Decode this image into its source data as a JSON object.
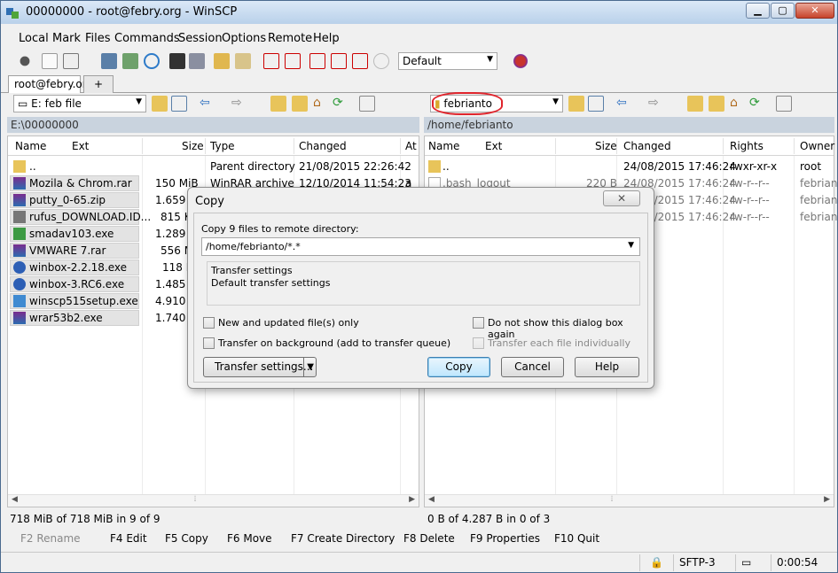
{
  "window": {
    "title": "00000000 - root@febry.org - WinSCP",
    "min": "▁",
    "max": "▢",
    "close": "✕"
  },
  "menu": [
    "Local",
    "Mark",
    "Files",
    "Commands",
    "Session",
    "Options",
    "Remote",
    "Help"
  ],
  "toolbar": {
    "transfer_profile": "Default"
  },
  "tabs": {
    "session": "root@febry.org",
    "new": "+"
  },
  "left_pane": {
    "drive": "E: feb file",
    "path": "E:\\00000000",
    "columns": [
      "Name",
      "Ext",
      "Size",
      "Type",
      "Changed",
      "At"
    ],
    "rows": [
      {
        "name": "..",
        "size": "",
        "type": "Parent directory",
        "changed": "21/08/2015  22:26:42",
        "attr": "",
        "icon": "folder-up-icon"
      },
      {
        "name": "Mozila & Chrom.rar",
        "size": "150 MiB",
        "type": "WinRAR archive",
        "changed": "12/10/2014  11:54:23",
        "attr": "a",
        "icon": "rar-icon"
      },
      {
        "name": "putty_0-65.zip",
        "size": "1.659 K",
        "type": "",
        "changed": "",
        "attr": "",
        "icon": "rar-icon"
      },
      {
        "name": "rufus_DOWNLOAD.ID...",
        "size": "815 K",
        "type": "",
        "changed": "",
        "attr": "",
        "icon": "usb-icon"
      },
      {
        "name": "smadav103.exe",
        "size": "1.289 K",
        "type": "",
        "changed": "",
        "attr": "",
        "icon": "exe-icon"
      },
      {
        "name": "VMWARE 7.rar",
        "size": "556 M",
        "type": "",
        "changed": "",
        "attr": "",
        "icon": "rar-icon"
      },
      {
        "name": "winbox-2.2.18.exe",
        "size": "118 K",
        "type": "",
        "changed": "",
        "attr": "",
        "icon": "winbox-icon"
      },
      {
        "name": "winbox-3.RC6.exe",
        "size": "1.485 K",
        "type": "",
        "changed": "",
        "attr": "",
        "icon": "winbox-icon"
      },
      {
        "name": "winscp515setup.exe",
        "size": "4.910 K",
        "type": "",
        "changed": "",
        "attr": "",
        "icon": "setup-icon"
      },
      {
        "name": "wrar53b2.exe",
        "size": "1.740 K",
        "type": "",
        "changed": "",
        "attr": "",
        "icon": "rar-icon"
      }
    ],
    "status": "718 MiB of 718 MiB in 9 of 9"
  },
  "right_pane": {
    "dir": "febrianto",
    "path": "/home/febrianto",
    "columns": [
      "Name",
      "Ext",
      "Size",
      "Changed",
      "Rights",
      "Owner"
    ],
    "rows": [
      {
        "name": "..",
        "size": "",
        "changed": "24/08/2015 17:46:24",
        "rights": "rwxr-xr-x",
        "owner": "root"
      },
      {
        "name": ".bash_logout",
        "size": "220 B",
        "changed": "24/08/2015 17:46:24",
        "rights": "rw-r--r--",
        "owner": "febriant"
      },
      {
        "name": "",
        "size": "",
        "changed": "24/08/2015 17:46:24",
        "rights": "rw-r--r--",
        "owner": "febriant"
      },
      {
        "name": "",
        "size": "",
        "changed": "24/08/2015 17:46:24",
        "rights": "rw-r--r--",
        "owner": "febriant"
      }
    ],
    "status": "0 B of 4.287 B in 0 of 3"
  },
  "fkeys": [
    "F2 Rename",
    "F4 Edit",
    "F5 Copy",
    "F6 Move",
    "F7 Create Directory",
    "F8 Delete",
    "F9 Properties",
    "F10 Quit"
  ],
  "statusbar": {
    "protocol": "SFTP-3",
    "time": "0:00:54"
  },
  "dialog": {
    "title": "Copy",
    "close": "✕",
    "prompt": "Copy 9 files to remote directory:",
    "target": "/home/febrianto/*.*",
    "group_title": "Transfer settings",
    "group_value": "Default transfer settings",
    "opt_new": "New and updated file(s) only",
    "opt_background": "Transfer on background (add to transfer queue)",
    "opt_dontshow": "Do not show this dialog box again",
    "opt_individually": "Transfer each file individually",
    "btn_settings": "Transfer settings...",
    "btn_copy": "Copy",
    "btn_cancel": "Cancel",
    "btn_help": "Help"
  }
}
